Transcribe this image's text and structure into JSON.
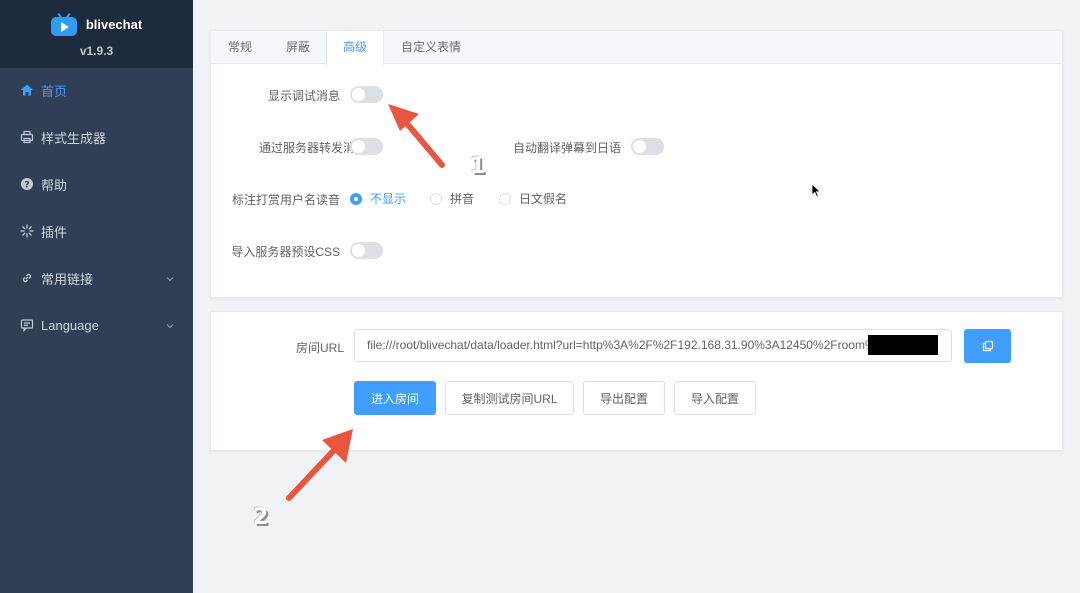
{
  "app": {
    "name": "blivechat",
    "version": "v1.9.3"
  },
  "sidebar": {
    "items": [
      {
        "label": "首页",
        "icon": "home-icon",
        "active": true
      },
      {
        "label": "样式生成器",
        "icon": "printer-icon",
        "active": false
      },
      {
        "label": "帮助",
        "icon": "help-icon",
        "active": false
      },
      {
        "label": "插件",
        "icon": "loading-icon",
        "active": false
      },
      {
        "label": "常用链接",
        "icon": "link-icon",
        "active": false,
        "expandable": true
      },
      {
        "label": "Language",
        "icon": "chat-icon",
        "active": false,
        "expandable": true
      }
    ]
  },
  "tabs": [
    {
      "label": "常规",
      "active": false
    },
    {
      "label": "屏蔽",
      "active": false
    },
    {
      "label": "高级",
      "active": true
    },
    {
      "label": "自定义表情",
      "active": false
    }
  ],
  "advanced": {
    "show_debug_label": "显示调试消息",
    "server_relay_label": "通过服务器转发消息",
    "auto_translate_label": "自动翻译弹幕到日语",
    "gift_reading_label": "标注打赏用户名读音",
    "gift_reading_options": [
      "不显示",
      "拼音",
      "日文假名"
    ],
    "gift_reading_selected": "不显示",
    "import_css_label": "导入服务器预设CSS"
  },
  "room": {
    "url_label": "房间URL",
    "url_value": "file:///root/blivechat/data/loader.html?url=http%3A%2F%2F192.168.31.90%3A12450%2Froom%2",
    "enter_room": "进入房间",
    "copy_test_url": "复制测试房间URL",
    "export_config": "导出配置",
    "import_config": "导入配置"
  },
  "annotations": {
    "step1": "1",
    "step2": "2"
  },
  "colors": {
    "accent": "#409eff",
    "sidebar": "#303f55",
    "arrow": "#e8563f"
  }
}
